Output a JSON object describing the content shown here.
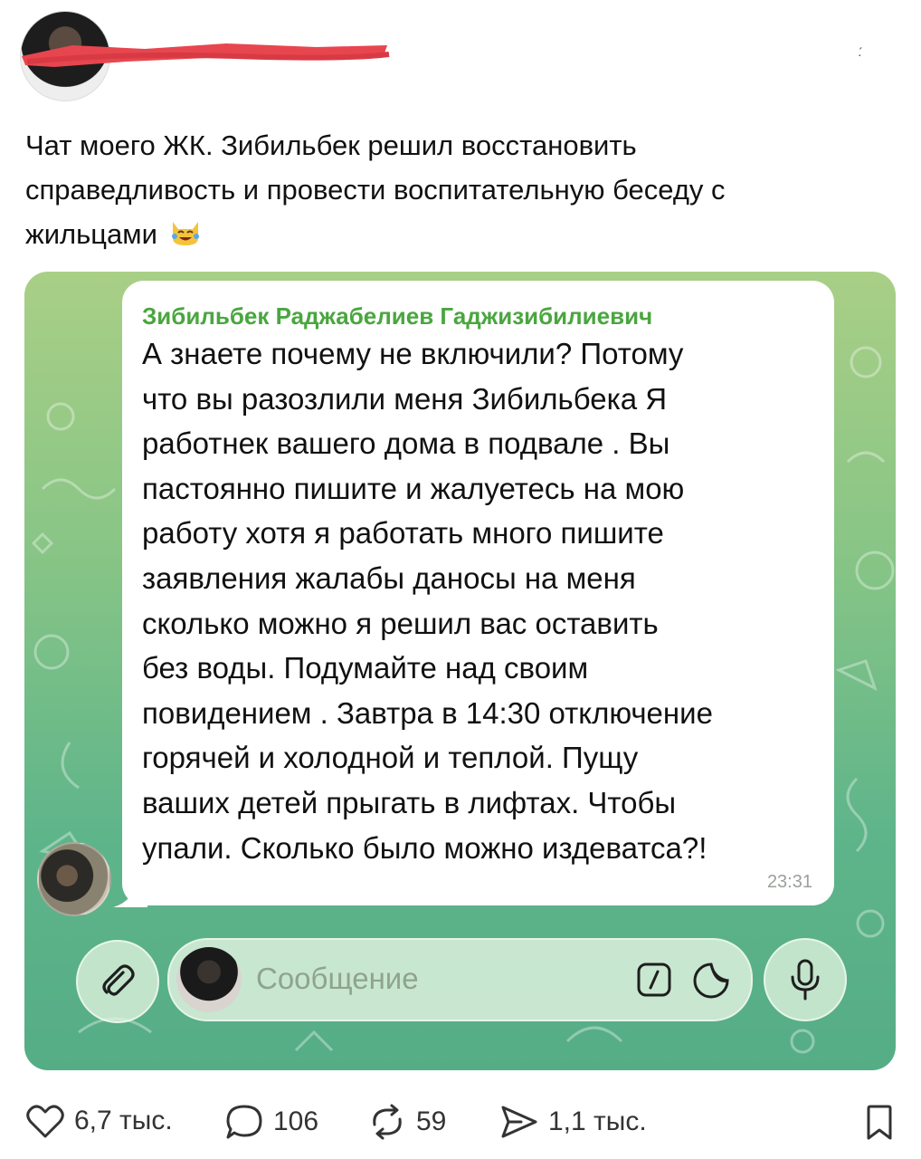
{
  "post": {
    "caption_line1": "Чат моего ЖК. Зибильбек решил восстановить",
    "caption_line2": "справедливость и провести воспитательную беседу с",
    "caption_line3": "жильцами"
  },
  "chat": {
    "sender": "Зибильбек Раджабелиев Гаджизибилиевич",
    "message_lines": [
      "А знаете почему не включили? Потому",
      "что вы разозлили меня Зибильбека Я",
      "работнек вашего дома в подвале . Вы",
      "пастоянно пишите и жалуетесь на мою",
      "работу хотя я работать много пишите",
      "заявления жалабы даносы на меня",
      "сколько можно я решил вас оставить",
      "без воды. Подумайте над своим",
      "повидением . Завтра в 14:30 отключение",
      "горячей и холодной и теплой. Пущу",
      "ваших детей прыгать в лифтах. Чтобы",
      "упали. Сколько было можно издеватса?!"
    ],
    "time": "23:31",
    "input_placeholder": "Сообщение"
  },
  "actions": {
    "likes": "6,7 тыс.",
    "comments": "106",
    "reposts": "59",
    "shares": "1,1 тыс."
  },
  "icons": {
    "like": "heart-icon",
    "comment": "comment-bubble-icon",
    "repost": "repost-icon",
    "share": "share-arrow-icon",
    "bookmark": "bookmark-icon",
    "attach": "paperclip-icon",
    "commands": "slash-command-icon",
    "sticker": "sticker-icon",
    "mic": "microphone-icon",
    "caption_emoji": "crying-laughing-cat-emoji"
  },
  "colors": {
    "sender_name": "#4aa63f",
    "chat_bg_top": "#a9cf86",
    "chat_bg_bottom": "#55ad86"
  }
}
